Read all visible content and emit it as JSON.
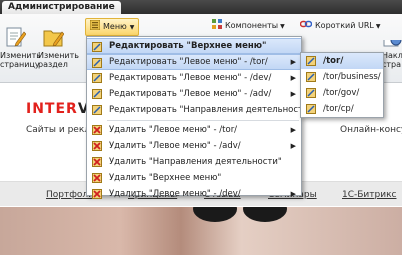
{
  "admin_tab": "Администрирование",
  "toolbar": {
    "menu_label": "Меню",
    "components_label": "Компоненты",
    "short_url_label": "Короткий URL",
    "edit_page_label": "Изменить страницу",
    "edit_section_label": "Изменить раздел",
    "right_button_label": "Накл стра"
  },
  "site": {
    "logo_first": "INTER",
    "logo_rest": "VO",
    "tagline": "Сайты и реклама",
    "online": "Онлайн-консул",
    "nav": [
      "Портфолио",
      "Принципы",
      "Отзывы",
      "Семинары",
      "1С-Битрикс"
    ]
  },
  "menu": {
    "items": [
      {
        "label": "Редактировать \"Верхнее меню\"",
        "icon": "edit-icon",
        "submenu": false,
        "highlight": true,
        "bold": true
      },
      {
        "label": "Редактировать \"Левое меню\" - /tor/",
        "icon": "edit-icon",
        "submenu": true,
        "highlight": true
      },
      {
        "label": "Редактировать \"Левое меню\" - /dev/",
        "icon": "edit-icon",
        "submenu": true
      },
      {
        "label": "Редактировать \"Левое меню\" - /adv/",
        "icon": "edit-icon",
        "submenu": true
      },
      {
        "label": "Редактировать \"Направления деятельности\"",
        "icon": "edit-icon",
        "submenu": false
      },
      {
        "label": "Удалить \"Левое меню\" - /tor/",
        "icon": "delete-icon",
        "submenu": true
      },
      {
        "label": "Удалить \"Левое меню\" - /adv/",
        "icon": "delete-icon",
        "submenu": true
      },
      {
        "label": "Удалить \"Направления деятельности\"",
        "icon": "delete-icon",
        "submenu": false
      },
      {
        "label": "Удалить \"Верхнее меню\"",
        "icon": "delete-icon",
        "submenu": false
      },
      {
        "label": "Удалить \"Левое меню\" - /dev/",
        "icon": "delete-icon",
        "submenu": true
      }
    ],
    "submenu_items": [
      "/tor/",
      "/tor/business/",
      "/tor/gov/",
      "/tor/cp/"
    ]
  }
}
